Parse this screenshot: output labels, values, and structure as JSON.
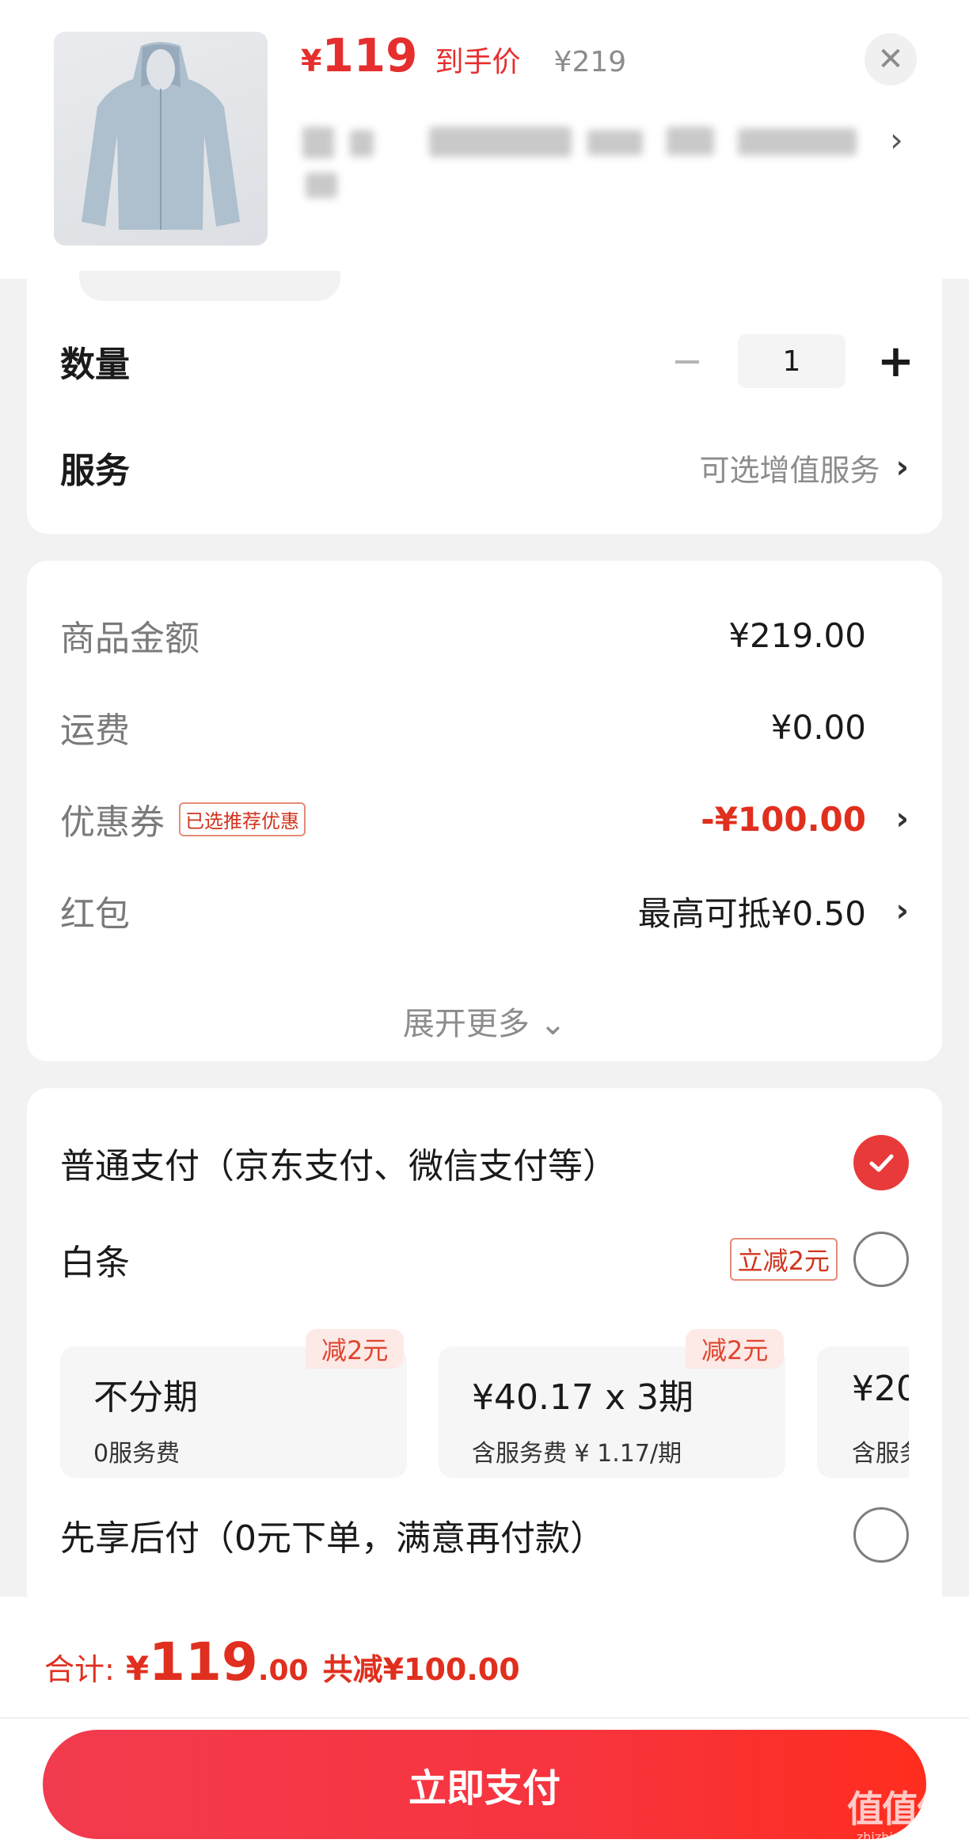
{
  "product": {
    "image_icon": "jacket-thumbnail-image",
    "price_symbol": "¥",
    "price": "119",
    "price_tag": "到手价",
    "original_price": "¥219",
    "close_label": "✕",
    "title_chevron": "›"
  },
  "quantity": {
    "label": "数量",
    "minus": "−",
    "value": "1",
    "plus": "+"
  },
  "service": {
    "label": "服务",
    "value": "可选增值服务",
    "chevron": "›"
  },
  "fees": {
    "goods_label": "商品金额",
    "goods_value": "¥219.00",
    "shipping_label": "运费",
    "shipping_value": "¥0.00",
    "coupon_label": "优惠券",
    "coupon_badge": "已选推荐优惠",
    "coupon_value": "-¥100.00",
    "coupon_chevron": "›",
    "redpacket_label": "红包",
    "redpacket_value": "最高可抵¥0.50",
    "redpacket_chevron": "›",
    "expand_label": "展开更多 ⌄"
  },
  "payment": {
    "normal_label": "普通支付（京东支付、微信支付等）",
    "baitiao_label": "白条",
    "baitiao_badge": "立减2元",
    "installments": [
      {
        "badge": "减2元",
        "title": "不分期",
        "sub": "0服务费"
      },
      {
        "badge": "减2元",
        "title": "¥40.17 x 3期",
        "sub": "含服务费 ¥ 1.17/期"
      },
      {
        "title": "¥20",
        "sub": "含服务"
      }
    ],
    "later_label": "先享后付（0元下单，满意再付款）",
    "colors": {
      "accent": "#e83a3a",
      "badge_bg": "#fde9e6"
    }
  },
  "bottom": {
    "total_label": "合计:",
    "total_symbol": "¥",
    "total_int": "119",
    "total_dec": ".00",
    "reduce_label": "共减¥100.00",
    "pay_button": "立即支付"
  },
  "watermark": {
    "main": "值值值",
    "sub": "zhizhizhi.com"
  }
}
